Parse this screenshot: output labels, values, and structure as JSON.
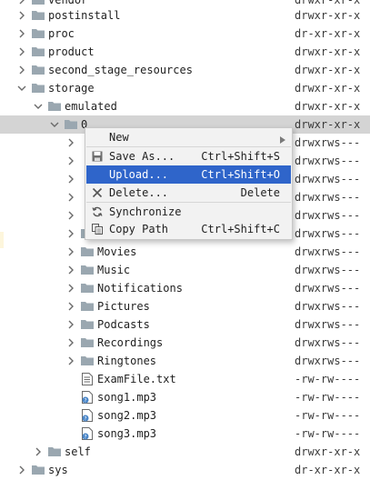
{
  "tree": {
    "rows": [
      {
        "name": "vendor",
        "perm": "drwxr-xr-x"
      },
      {
        "name": "postinstall",
        "perm": "drwxr-xr-x"
      },
      {
        "name": "proc",
        "perm": "dr-xr-xr-x"
      },
      {
        "name": "product",
        "perm": "drwxr-xr-x"
      },
      {
        "name": "second_stage_resources",
        "perm": "drwxr-xr-x"
      },
      {
        "name": "storage",
        "perm": "drwxr-xr-x"
      },
      {
        "name": "emulated",
        "perm": "drwxr-xr-x"
      },
      {
        "name": "0",
        "perm": "drwxr-xr-x"
      },
      {
        "name": "",
        "perm": "drwxrws---"
      },
      {
        "name": "",
        "perm": "drwxrws---"
      },
      {
        "name": "",
        "perm": "drwxrws---"
      },
      {
        "name": "",
        "perm": "drwxrws---"
      },
      {
        "name": "",
        "perm": "drwxrws---"
      },
      {
        "name": "",
        "perm": "drwxrws---"
      },
      {
        "name": "Movies",
        "perm": "drwxrws---"
      },
      {
        "name": "Music",
        "perm": "drwxrws---"
      },
      {
        "name": "Notifications",
        "perm": "drwxrws---"
      },
      {
        "name": "Pictures",
        "perm": "drwxrws---"
      },
      {
        "name": "Podcasts",
        "perm": "drwxrws---"
      },
      {
        "name": "Recordings",
        "perm": "drwxrws---"
      },
      {
        "name": "Ringtones",
        "perm": "drwxrws---"
      },
      {
        "name": "ExamFile.txt",
        "perm": "-rw-rw----"
      },
      {
        "name": "song1.mp3",
        "perm": "-rw-rw----"
      },
      {
        "name": "song2.mp3",
        "perm": "-rw-rw----"
      },
      {
        "name": "song3.mp3",
        "perm": "-rw-rw----"
      },
      {
        "name": "self",
        "perm": "drwxr-xr-x"
      },
      {
        "name": "sys",
        "perm": "dr-xr-xr-x"
      }
    ]
  },
  "context_menu": {
    "items": [
      {
        "label": "New",
        "shortcut": "",
        "icon": "none",
        "submenu": true
      },
      {
        "label": "Save As...",
        "shortcut": "Ctrl+Shift+S",
        "icon": "save-icon"
      },
      {
        "label": "Upload...",
        "shortcut": "Ctrl+Shift+O",
        "icon": "none",
        "highlighted": true
      },
      {
        "label": "Delete...",
        "shortcut": "Delete",
        "icon": "delete-icon"
      },
      {
        "label": "Synchronize",
        "shortcut": "",
        "icon": "sync-icon"
      },
      {
        "label": "Copy Path",
        "shortcut": "Ctrl+Shift+C",
        "icon": "copy-icon"
      }
    ]
  },
  "colors": {
    "highlight": "#2f65ca",
    "selected_row": "#d4d4d4",
    "folder": "#9aa7b0"
  }
}
